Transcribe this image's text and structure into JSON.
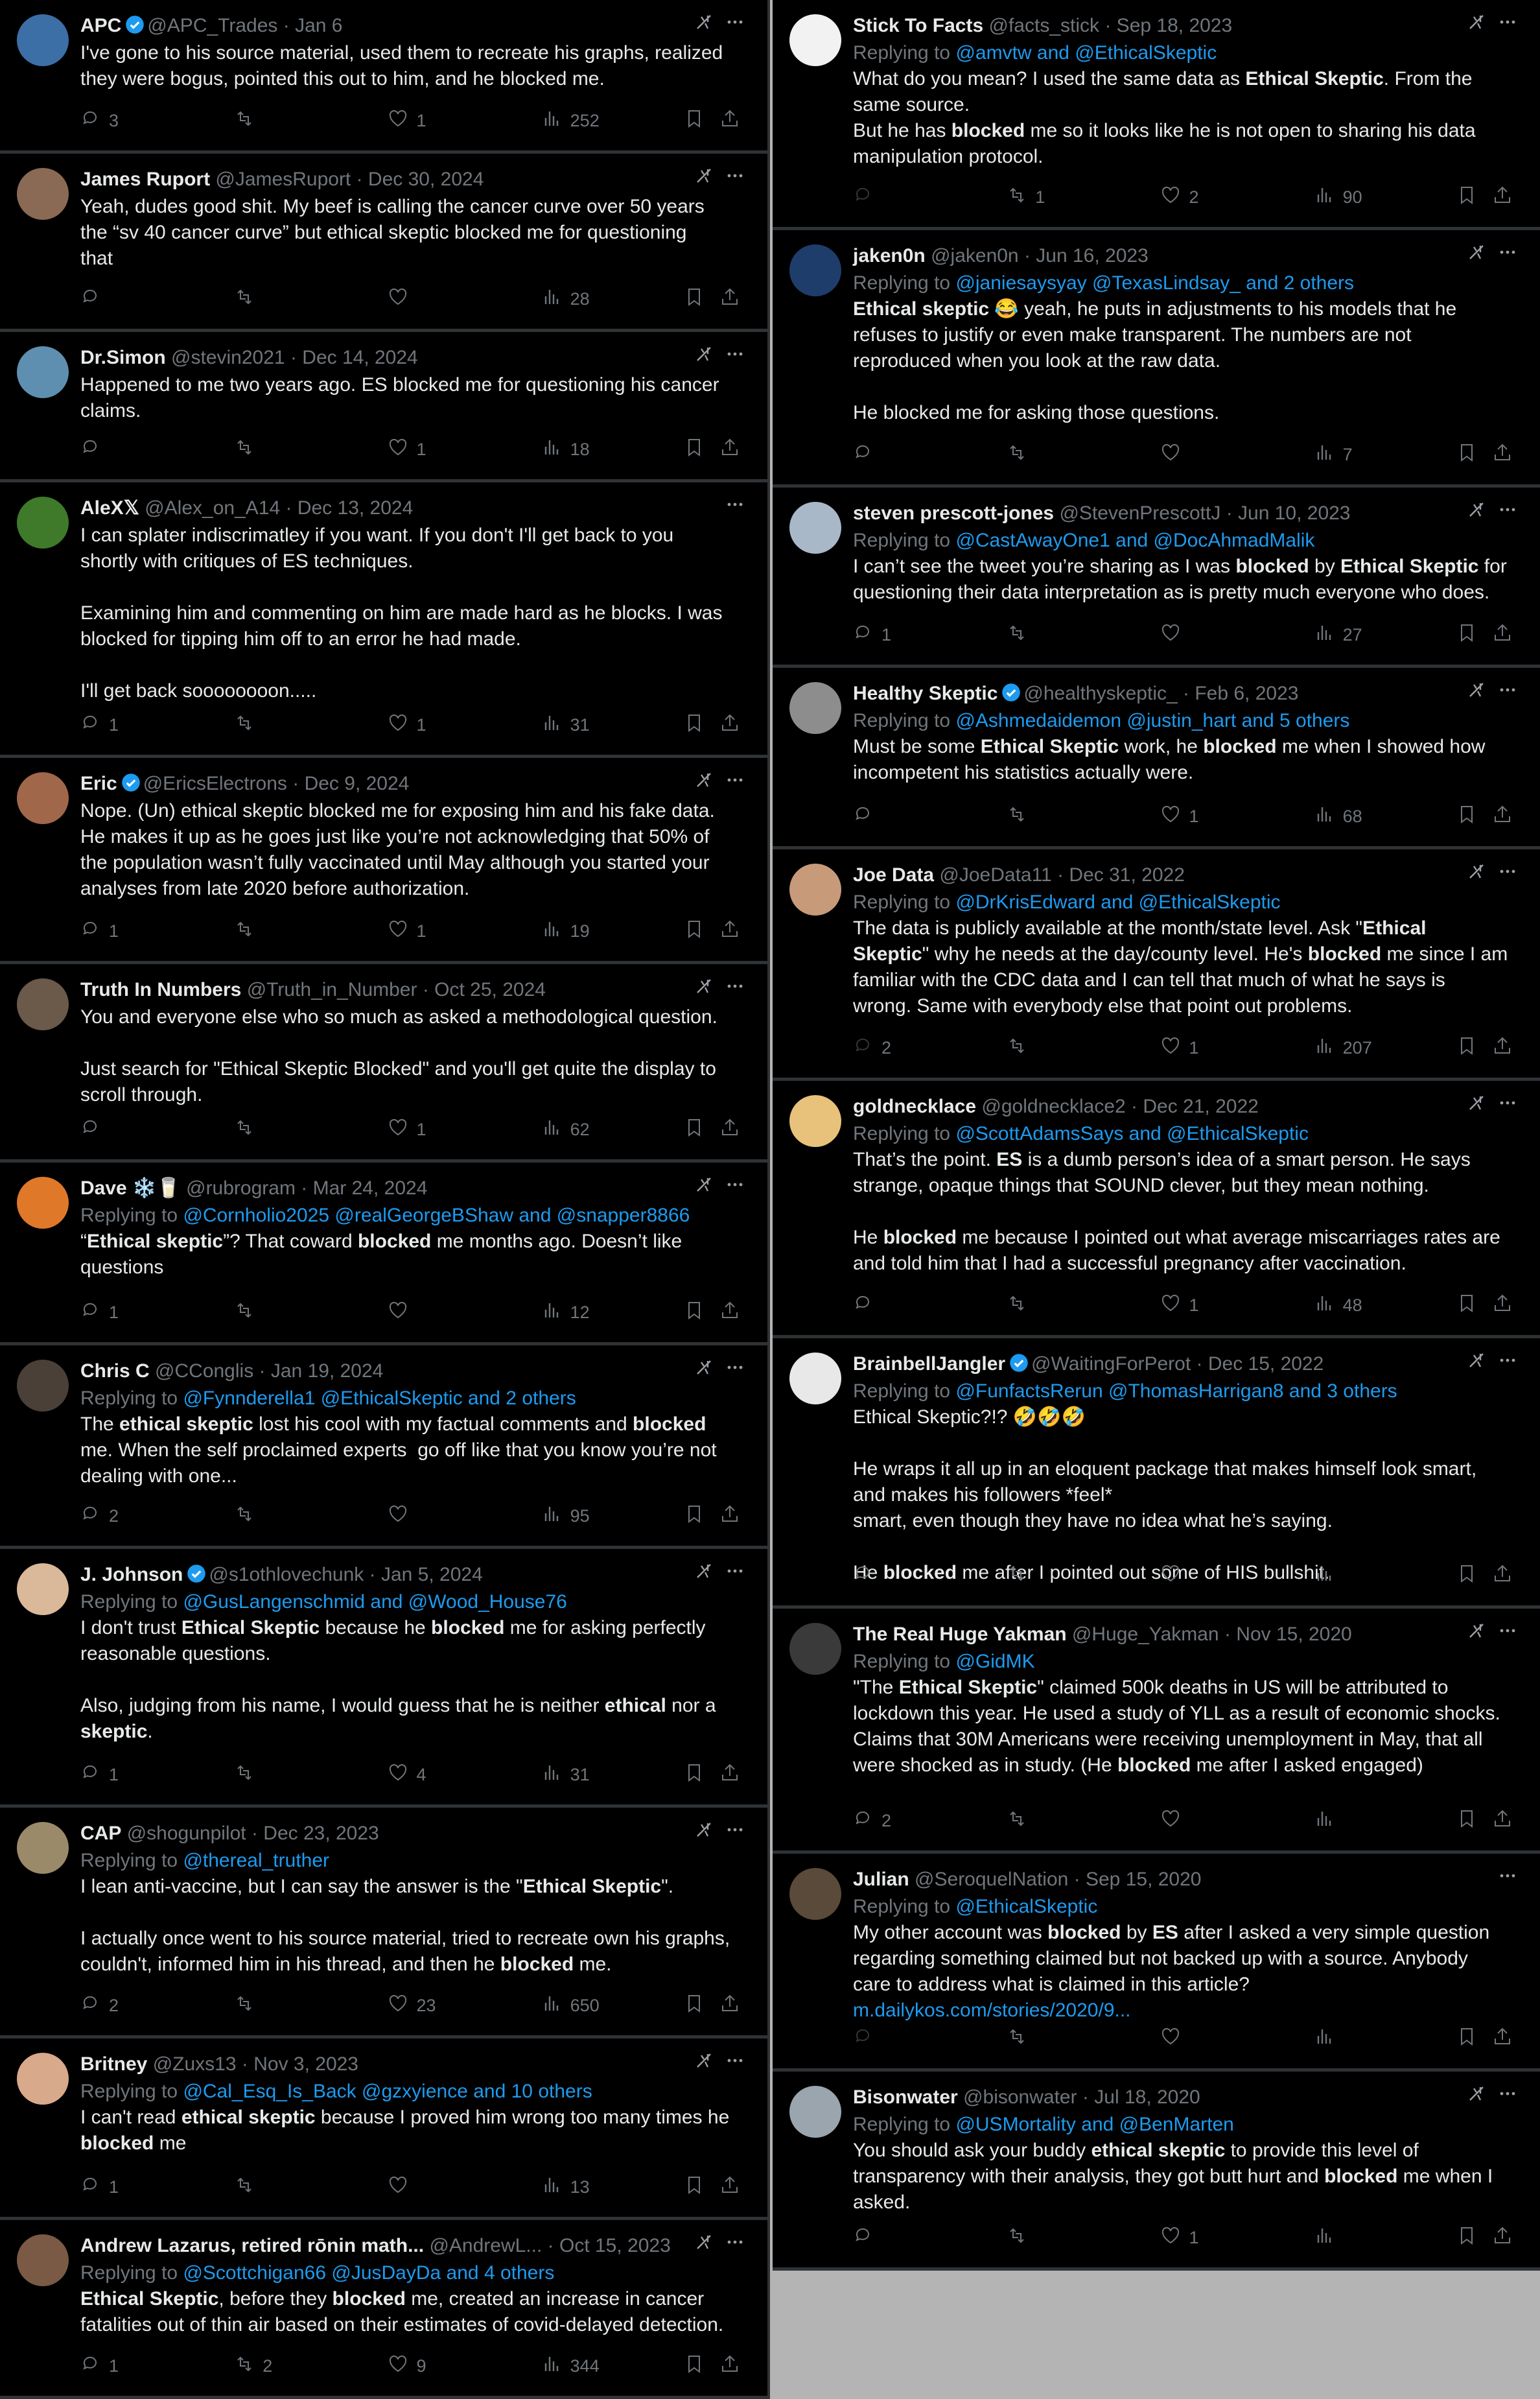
{
  "colors": {
    "link": "#1d9bf0",
    "muted": "#71767b",
    "text": "#e7e9ea",
    "bg": "#000000",
    "divider": "#2f3336"
  },
  "icons": {
    "reply": "reply-icon",
    "retweet": "retweet-icon",
    "like": "heart-icon",
    "views": "views-chart-icon",
    "bookmark": "bookmark-icon",
    "share": "share-icon",
    "grok": "grok-icon",
    "more": "more-icon"
  },
  "left": [
    {
      "name": "APC",
      "verified": true,
      "handle": "@APC_Trades",
      "date": "· Jan 6",
      "avatar": "#3b6fa5",
      "grok": true,
      "replying": null,
      "segments": [
        [
          "I've gone to his source material, used them to recreate his graphs, realized\nthey were bogus, pointed this out to him, and he blocked me.",
          0
        ]
      ],
      "stats": {
        "reply": "3",
        "retweet": "",
        "like": "1",
        "views": "252"
      }
    },
    {
      "name": "James Ruport",
      "verified": false,
      "handle": "@JamesRuport",
      "date": "· Dec 30, 2024",
      "avatar": "#8a6a55",
      "grok": true,
      "replying": null,
      "segments": [
        [
          "Yeah, dudes good shit. My beef is calling the cancer curve over 50 years\nthe “sv 40 cancer curve” but ethical skeptic blocked me for questioning\nthat",
          0
        ]
      ],
      "stats": {
        "reply": "",
        "retweet": "",
        "like": "",
        "views": "28"
      }
    },
    {
      "name": "Dr.Simon",
      "verified": false,
      "handle": "@stevin2021",
      "date": "· Dec 14, 2024",
      "avatar": "#5f8fb0",
      "grok": true,
      "replying": null,
      "segments": [
        [
          "Happened to me two years ago. ES blocked me for questioning his cancer\nclaims.",
          0
        ]
      ],
      "stats": {
        "reply": "",
        "retweet": "",
        "like": "1",
        "views": "18"
      }
    },
    {
      "name": "AleX𝕏",
      "verified": false,
      "handle": "@Alex_on_A14",
      "date": "· Dec 13, 2024",
      "avatar": "#3f7a2a",
      "grok": false,
      "replying": null,
      "segments": [
        [
          "I can splater indiscrimatley if you want. If you don't I'll get back to you\nshortly with critiques of ES techniques.\n\nExamining him and commenting on him are made hard as he blocks. I was\nblocked for tipping him off to an error he had made.\n\nI'll get back soooooooon.....",
          0
        ]
      ],
      "stats": {
        "reply": "1",
        "retweet": "",
        "like": "1",
        "views": "31"
      }
    },
    {
      "name": "Eric",
      "verified": true,
      "handle": "@EricsElectrons",
      "date": "· Dec 9, 2024",
      "avatar": "#a0674a",
      "grok": true,
      "replying": null,
      "segments": [
        [
          "Nope. (Un) ethical skeptic blocked me for exposing him and his fake data.\nHe makes it up as he goes just like you’re not acknowledging that 50% of\nthe population wasn’t fully vaccinated until May although you started your\nanalyses from late 2020 before authorization.",
          0
        ]
      ],
      "stats": {
        "reply": "1",
        "retweet": "",
        "like": "1",
        "views": "19"
      }
    },
    {
      "name": "Truth In Numbers",
      "verified": false,
      "handle": "@Truth_in_Number",
      "date": "· Oct 25, 2024",
      "avatar": "#6b5a4a",
      "grok": true,
      "replying": null,
      "segments": [
        [
          "You and everyone else who so much as asked a methodological question.\n\nJust search for \"Ethical Skeptic Blocked\" and you'll get quite the display to\nscroll through.",
          0
        ]
      ],
      "stats": {
        "reply": "",
        "retweet": "",
        "like": "1",
        "views": "62"
      }
    },
    {
      "name": "Dave ❄️🥛",
      "verified": false,
      "handle": "@rubrogram",
      "date": "· Mar 24, 2024",
      "avatar": "#e0782a",
      "grok": true,
      "replying": [
        [
          "@Cornholio2025",
          1
        ],
        [
          " ",
          0
        ],
        [
          "@realGeorgeBShaw",
          1
        ],
        [
          " and ",
          1
        ],
        [
          "@snapper8866",
          1
        ]
      ],
      "segments": [
        [
          "“",
          0
        ],
        [
          "Ethical skeptic",
          1
        ],
        [
          "”? That coward ",
          0
        ],
        [
          "blocked",
          1
        ],
        [
          " me months ago. Doesn’t like\nquestions",
          0
        ]
      ],
      "stats": {
        "reply": "1",
        "retweet": "",
        "like": "",
        "views": "12"
      }
    },
    {
      "name": "Chris C",
      "verified": false,
      "handle": "@CConglis",
      "date": "· Jan 19, 2024",
      "avatar": "#4a4038",
      "grok": true,
      "replying": [
        [
          "@Fynnderella1",
          1
        ],
        [
          " ",
          0
        ],
        [
          "@EthicalSkeptic",
          1
        ],
        [
          " and 2 others",
          1
        ]
      ],
      "segments": [
        [
          "The ",
          0
        ],
        [
          "ethical skeptic",
          1
        ],
        [
          " lost his cool with my factual comments and ",
          0
        ],
        [
          "blocked",
          1
        ],
        [
          "\nme. When the self proclaimed experts  go off like that you know you’re not\ndealing with one...",
          0
        ]
      ],
      "stats": {
        "reply": "2",
        "retweet": "",
        "like": "",
        "views": "95"
      }
    },
    {
      "name": "J. Johnson",
      "verified": true,
      "handle": "@s1othlovechunk",
      "date": "· Jan 5, 2024",
      "avatar": "#d9b99a",
      "grok": true,
      "replying": [
        [
          "@GusLangenschmid",
          1
        ],
        [
          " and ",
          1
        ],
        [
          "@Wood_House76",
          1
        ]
      ],
      "segments": [
        [
          "I don't trust ",
          0
        ],
        [
          "Ethical Skeptic",
          1
        ],
        [
          " because he ",
          0
        ],
        [
          "blocked",
          1
        ],
        [
          " me for asking perfectly\nreasonable questions.\n\nAlso, judging from his name, I would guess that he is neither ",
          0
        ],
        [
          "ethical",
          1
        ],
        [
          " nor a\n",
          0
        ],
        [
          "skeptic",
          1
        ],
        [
          ".",
          0
        ]
      ],
      "stats": {
        "reply": "1",
        "retweet": "",
        "like": "4",
        "views": "31"
      }
    },
    {
      "name": "CAP",
      "verified": false,
      "handle": "@shogunpilot",
      "date": "· Dec 23, 2023",
      "avatar": "#9a8a6a",
      "grok": true,
      "replying": [
        [
          "@thereal_truther",
          1
        ]
      ],
      "segments": [
        [
          "I lean anti-vaccine, but I can say the answer is the \"",
          0
        ],
        [
          "Ethical Skeptic",
          1
        ],
        [
          "\".\n\nI actually once went to his source material, tried to recreate own his graphs,\ncouldn't, informed him in his thread, and then he ",
          0
        ],
        [
          "blocked",
          1
        ],
        [
          " me.",
          0
        ]
      ],
      "stats": {
        "reply": "2",
        "retweet": "",
        "like": "23",
        "views": "650"
      }
    },
    {
      "name": "Britney",
      "verified": false,
      "handle": "@Zuxs13",
      "date": "· Nov 3, 2023",
      "avatar": "#d8a98a",
      "grok": true,
      "replying": [
        [
          "@Cal_Esq_Is_Back",
          1
        ],
        [
          " ",
          0
        ],
        [
          "@gzxyience",
          1
        ],
        [
          " and 10 others",
          1
        ]
      ],
      "segments": [
        [
          "I can't read ",
          0
        ],
        [
          "ethical skeptic",
          1
        ],
        [
          " because I proved him wrong too many times he\n",
          0
        ],
        [
          "blocked",
          1
        ],
        [
          " me",
          0
        ]
      ],
      "stats": {
        "reply": "1",
        "retweet": "",
        "like": "",
        "views": "13"
      }
    },
    {
      "name": "Andrew Lazarus, retired rōnin math...",
      "verified": false,
      "handle": "@AndrewL...",
      "date": "· Oct 15, 2023",
      "avatar": "#7a5a45",
      "grok": true,
      "replying": [
        [
          "@Scottchigan66",
          1
        ],
        [
          " ",
          0
        ],
        [
          "@JusDayDa",
          1
        ],
        [
          " and 4 others",
          1
        ]
      ],
      "segments": [
        [
          "Ethical Skeptic",
          1
        ],
        [
          ", before they ",
          0
        ],
        [
          "blocked",
          1
        ],
        [
          " me, created an increase in cancer\nfatalities out of thin air based on their estimates of covid-delayed detection.",
          0
        ]
      ],
      "stats": {
        "reply": "1",
        "retweet": "2",
        "like": "9",
        "views": "344"
      }
    }
  ],
  "right": [
    {
      "name": "Stick To Facts",
      "verified": false,
      "handle": "@facts_stick",
      "date": "· Sep 18, 2023",
      "avatar": "#f2f2f2",
      "grok": true,
      "replying": [
        [
          "@amvtw",
          1
        ],
        [
          " and ",
          1
        ],
        [
          "@EthicalSkeptic",
          1
        ]
      ],
      "segments": [
        [
          "What do you mean? I used the same data as ",
          0
        ],
        [
          "Ethical Skeptic",
          1
        ],
        [
          ". From the\nsame source.\nBut he has ",
          0
        ],
        [
          "blocked",
          1
        ],
        [
          " me so it looks like he is not open to sharing his data\nmanipulation protocol.",
          0
        ]
      ],
      "stats": {
        "reply": "",
        "retweet": "1",
        "like": "2",
        "views": "90"
      }
    },
    {
      "name": "jaken0n",
      "verified": false,
      "handle": "@jaken0n",
      "date": "· Jun 16, 2023",
      "avatar": "#1f3d6b",
      "grok": true,
      "replying": [
        [
          "@janiesaysyay",
          1
        ],
        [
          " ",
          0
        ],
        [
          "@TexasLindsay_",
          1
        ],
        [
          " and 2 others",
          1
        ]
      ],
      "segments": [
        [
          "Ethical skeptic",
          1
        ],
        [
          " 😂 yeah, he puts in adjustments to his models that he\nrefuses to justify or even make transparent. The numbers are not\nreproduced when you look at the raw data.\n\nHe blocked me for asking those questions.",
          0
        ]
      ],
      "stats": {
        "reply": "",
        "retweet": "",
        "like": "",
        "views": "7"
      }
    },
    {
      "name": "steven prescott-jones",
      "verified": false,
      "handle": "@StevenPrescottJ",
      "date": "· Jun 10, 2023",
      "avatar": "#a8b8c8",
      "grok": true,
      "replying": [
        [
          "@CastAwayOne1",
          1
        ],
        [
          " and ",
          1
        ],
        [
          "@DocAhmadMalik",
          1
        ]
      ],
      "segments": [
        [
          "I can’t see the tweet you’re sharing as I was ",
          0
        ],
        [
          "blocked",
          1
        ],
        [
          " by ",
          0
        ],
        [
          "Ethical Skeptic",
          1
        ],
        [
          " for\nquestioning their data interpretation as is pretty much everyone who does.",
          0
        ]
      ],
      "stats": {
        "reply": "1",
        "retweet": "",
        "like": "",
        "views": "27"
      }
    },
    {
      "name": "Healthy Skeptic",
      "verified": true,
      "handle": "@healthyskeptic_",
      "date": "· Feb 6, 2023",
      "avatar": "#8d8d8d",
      "grok": true,
      "replying": [
        [
          "@Ashmedaidemon",
          1
        ],
        [
          " ",
          0
        ],
        [
          "@justin_hart",
          1
        ],
        [
          " and 5 others",
          1
        ]
      ],
      "segments": [
        [
          "Must be some ",
          0
        ],
        [
          "Ethical Skeptic",
          1
        ],
        [
          " work, he ",
          0
        ],
        [
          "blocked",
          1
        ],
        [
          " me when I showed how\nincompetent his statistics actually were.",
          0
        ]
      ],
      "stats": {
        "reply": "",
        "retweet": "",
        "like": "1",
        "views": "68"
      }
    },
    {
      "name": "Joe Data",
      "verified": false,
      "handle": "@JoeData11",
      "date": "· Dec 31, 2022",
      "avatar": "#c79a7a",
      "grok": true,
      "replying": [
        [
          "@DrKrisEdward",
          1
        ],
        [
          " and ",
          1
        ],
        [
          "@EthicalSkeptic",
          1
        ]
      ],
      "segments": [
        [
          "The data is publicly available at the month/state level. Ask \"",
          0
        ],
        [
          "Ethical\nSkeptic",
          1
        ],
        [
          "\" why he needs at the day/county level. He's ",
          0
        ],
        [
          "blocked",
          1
        ],
        [
          " me since I am\nfamiliar with the CDC data and I can tell that much of what he says is\nwrong. Same with everybody else that point out problems.",
          0
        ]
      ],
      "stats": {
        "reply": "2",
        "retweet": "",
        "like": "1",
        "views": "207"
      }
    },
    {
      "name": "goldnecklace",
      "verified": false,
      "handle": "@goldnecklace2",
      "date": "· Dec 21, 2022",
      "avatar": "#e8c27a",
      "grok": true,
      "replying": [
        [
          "@ScottAdamsSays",
          1
        ],
        [
          " and ",
          1
        ],
        [
          "@EthicalSkeptic",
          1
        ]
      ],
      "segments": [
        [
          "That’s the point. ",
          0
        ],
        [
          "ES",
          1
        ],
        [
          " is a dumb person’s idea of a smart person. He says\nstrange, opaque things that SOUND clever, but they mean nothing.\n\nHe ",
          0
        ],
        [
          "blocked",
          1
        ],
        [
          " me because I pointed out what average miscarriages rates are\nand told him that I had a successful pregnancy after vaccination.",
          0
        ]
      ],
      "stats": {
        "reply": "",
        "retweet": "",
        "like": "1",
        "views": "48"
      }
    },
    {
      "name": "BrainbellJangler",
      "verified": true,
      "handle": "@WaitingForPerot",
      "date": "· Dec 15, 2022",
      "avatar": "#e8e8e8",
      "grok": true,
      "replying": [
        [
          "@FunfactsRerun",
          1
        ],
        [
          " ",
          0
        ],
        [
          "@ThomasHarrigan8",
          1
        ],
        [
          " and 3 others",
          1
        ]
      ],
      "segments": [
        [
          "Ethical Skeptic?!? 🤣🤣🤣\n\nHe wraps it all up in an eloquent package that makes himself look smart,\nand makes his followers *feel*\nsmart, even though they have no idea what he’s saying.\n\nHe ",
          0
        ],
        [
          "blocked",
          1
        ],
        [
          " me after I pointed out some of HIS bullshit.",
          0
        ]
      ],
      "stats": {
        "reply": "",
        "retweet": "",
        "like": "",
        "views": ""
      }
    },
    {
      "name": "The Real Huge Yakman",
      "verified": false,
      "handle": "@Huge_Yakman",
      "date": "· Nov 15, 2020",
      "avatar": "#3a3a3a",
      "grok": true,
      "replying": [
        [
          "@GidMK",
          1
        ]
      ],
      "segments": [
        [
          "\"The ",
          0
        ],
        [
          "Ethical Skeptic",
          1
        ],
        [
          "\" claimed 500k deaths in US will be attributed to\nlockdown this year. He used a study of YLL as a result of economic shocks.\nClaims that 30M Americans were receiving unemployment in May, that all\nwere shocked as in study. (He ",
          0
        ],
        [
          "blocked",
          1
        ],
        [
          " me after I asked engaged)",
          0
        ]
      ],
      "stats": {
        "reply": "2",
        "retweet": "",
        "like": "",
        "views": ""
      }
    },
    {
      "name": "Julian",
      "verified": false,
      "handle": "@SeroquelNation",
      "date": "· Sep 15, 2020",
      "avatar": "#5a4a3a",
      "grok": false,
      "replying": [
        [
          "@EthicalSkeptic",
          1
        ]
      ],
      "segments": [
        [
          "My other account was ",
          0
        ],
        [
          "blocked",
          1
        ],
        [
          " by ",
          0
        ],
        [
          "ES",
          1
        ],
        [
          " after I asked a very simple question\nregarding something claimed but not backed up with a source. Anybody\ncare to address what is claimed in this article?\n",
          0
        ],
        [
          "m.dailykos.com/stories/2020/9...",
          2
        ]
      ],
      "stats": {
        "reply": "",
        "retweet": "",
        "like": "",
        "views": ""
      }
    },
    {
      "name": "Bisonwater",
      "verified": false,
      "handle": "@bisonwater",
      "date": "· Jul 18, 2020",
      "avatar": "#9aa5ae",
      "grok": true,
      "replying": [
        [
          "@USMortality",
          1
        ],
        [
          " and ",
          1
        ],
        [
          "@BenMarten",
          1
        ]
      ],
      "segments": [
        [
          "You should ask your buddy ",
          0
        ],
        [
          "ethical skeptic",
          1
        ],
        [
          " to provide this level of\ntransparency with their analysis, they got butt hurt and ",
          0
        ],
        [
          "blocked",
          1
        ],
        [
          " me when I\nasked.",
          0
        ]
      ],
      "stats": {
        "reply": "",
        "retweet": "",
        "like": "1",
        "views": ""
      }
    }
  ]
}
